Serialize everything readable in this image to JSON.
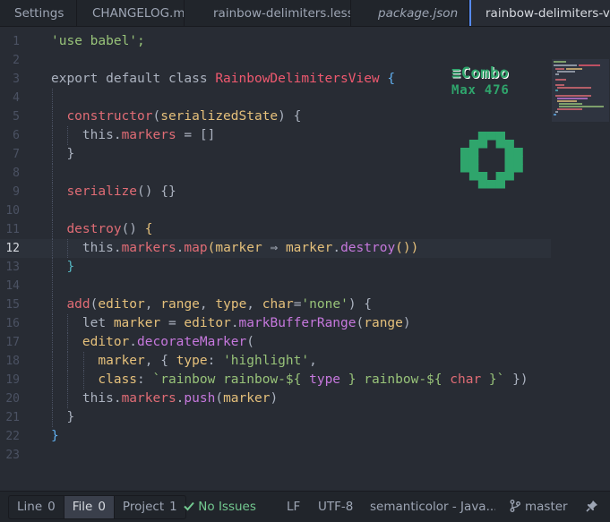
{
  "tabs": [
    {
      "label": "Settings"
    },
    {
      "label": "CHANGELOG.md"
    },
    {
      "label": "rainbow-delimiters.less"
    },
    {
      "label": "package.json"
    },
    {
      "label": "rainbow-delimiters-view.js"
    }
  ],
  "editor": {
    "current_line": 12,
    "lines": [
      {
        "n": "1",
        "indent": 0,
        "tokens": [
          [
            "str",
            "'use babel';"
          ]
        ]
      },
      {
        "n": "2",
        "indent": 0,
        "tokens": []
      },
      {
        "n": "3",
        "indent": 0,
        "tokens": [
          [
            "kw",
            "export default class "
          ],
          [
            "cls",
            "RainbowDelimitersView"
          ],
          [
            "plain",
            " "
          ],
          [
            "br3",
            "{"
          ]
        ]
      },
      {
        "n": "4",
        "indent": 1,
        "tokens": []
      },
      {
        "n": "5",
        "indent": 1,
        "tokens": [
          [
            "fn",
            "constructor"
          ],
          [
            "plain",
            "("
          ],
          [
            "pm",
            "serializedState"
          ],
          [
            "plain",
            ") {"
          ]
        ]
      },
      {
        "n": "6",
        "indent": 2,
        "tokens": [
          [
            "ths",
            "this"
          ],
          [
            "plain",
            "."
          ],
          [
            "prop",
            "markers"
          ],
          [
            "plain",
            " = []"
          ]
        ]
      },
      {
        "n": "7",
        "indent": 1,
        "tokens": [
          [
            "plain",
            "}"
          ]
        ]
      },
      {
        "n": "8",
        "indent": 1,
        "tokens": []
      },
      {
        "n": "9",
        "indent": 1,
        "tokens": [
          [
            "fn",
            "serialize"
          ],
          [
            "plain",
            "() {}"
          ]
        ]
      },
      {
        "n": "10",
        "indent": 1,
        "tokens": []
      },
      {
        "n": "11",
        "indent": 1,
        "tokens": [
          [
            "fn",
            "destroy"
          ],
          [
            "plain",
            "() "
          ],
          [
            "br2",
            "{"
          ]
        ]
      },
      {
        "n": "12",
        "indent": 2,
        "tokens": [
          [
            "ths",
            "this"
          ],
          [
            "plain",
            "."
          ],
          [
            "prop",
            "markers"
          ],
          [
            "plain",
            "."
          ],
          [
            "fn",
            "map"
          ],
          [
            "br2",
            "("
          ],
          [
            "pm",
            "marker"
          ],
          [
            "plain",
            " ⇒ "
          ],
          [
            "pm",
            "marker"
          ],
          [
            "plain",
            "."
          ],
          [
            "fb",
            "destroy"
          ],
          [
            "br2",
            "()"
          ],
          [
            "br2",
            ")"
          ]
        ]
      },
      {
        "n": "13",
        "indent": 1,
        "tokens": [
          [
            "br1",
            "}"
          ]
        ]
      },
      {
        "n": "14",
        "indent": 1,
        "tokens": []
      },
      {
        "n": "15",
        "indent": 1,
        "tokens": [
          [
            "fn",
            "add"
          ],
          [
            "plain",
            "("
          ],
          [
            "pm",
            "editor"
          ],
          [
            "plain",
            ", "
          ],
          [
            "pm",
            "range"
          ],
          [
            "plain",
            ", "
          ],
          [
            "pm",
            "type"
          ],
          [
            "plain",
            ", "
          ],
          [
            "pm",
            "char"
          ],
          [
            "plain",
            "="
          ],
          [
            "str",
            "'none'"
          ],
          [
            "plain",
            ") {"
          ]
        ]
      },
      {
        "n": "16",
        "indent": 2,
        "tokens": [
          [
            "kw",
            "let "
          ],
          [
            "pm",
            "marker"
          ],
          [
            "plain",
            " = "
          ],
          [
            "pm",
            "editor"
          ],
          [
            "plain",
            "."
          ],
          [
            "fb",
            "markBufferRange"
          ],
          [
            "plain",
            "("
          ],
          [
            "pm",
            "range"
          ],
          [
            "plain",
            ")"
          ]
        ]
      },
      {
        "n": "17",
        "indent": 2,
        "tokens": [
          [
            "pm",
            "editor"
          ],
          [
            "plain",
            "."
          ],
          [
            "fb",
            "decorateMarker"
          ],
          [
            "plain",
            "("
          ]
        ]
      },
      {
        "n": "18",
        "indent": 3,
        "tokens": [
          [
            "pm",
            "marker"
          ],
          [
            "plain",
            ", { "
          ],
          [
            "pm",
            "type"
          ],
          [
            "plain",
            ": "
          ],
          [
            "str",
            "'highlight'"
          ],
          [
            "plain",
            ","
          ]
        ]
      },
      {
        "n": "19",
        "indent": 3,
        "tokens": [
          [
            "pm",
            "class"
          ],
          [
            "plain",
            ": "
          ],
          [
            "str",
            "`rainbow rainbow-${ "
          ],
          [
            "ty",
            "type"
          ],
          [
            "str",
            " } rainbow-${ "
          ],
          [
            "ch",
            "char"
          ],
          [
            "str",
            " }`"
          ],
          [
            "plain",
            " })"
          ]
        ]
      },
      {
        "n": "20",
        "indent": 2,
        "tokens": [
          [
            "ths",
            "this"
          ],
          [
            "plain",
            "."
          ],
          [
            "prop",
            "markers"
          ],
          [
            "plain",
            "."
          ],
          [
            "fb",
            "push"
          ],
          [
            "plain",
            "("
          ],
          [
            "pm",
            "marker"
          ],
          [
            "plain",
            ")"
          ]
        ]
      },
      {
        "n": "21",
        "indent": 1,
        "tokens": [
          [
            "plain",
            "}"
          ]
        ]
      },
      {
        "n": "22",
        "indent": 0,
        "tokens": [
          [
            "br3",
            "}"
          ]
        ]
      },
      {
        "n": "23",
        "indent": 0,
        "tokens": []
      }
    ]
  },
  "combo": {
    "label": "≡Combo",
    "max_label": "Max 476",
    "count": 0,
    "color": "#2fa56c"
  },
  "status": {
    "line_tab": {
      "label": "Line",
      "count": "0"
    },
    "file_tab": {
      "label": "File",
      "count": "0"
    },
    "project_tab": {
      "label": "Project",
      "count": "1"
    },
    "issues_icon": "check-icon",
    "issues": "No Issues",
    "line_ending": "LF",
    "encoding": "UTF-8",
    "grammar": "semanticolor - Java...",
    "branch_icon": "git-branch-icon",
    "branch": "master",
    "pin_icon": "pin-icon"
  },
  "colors": {
    "background": "#282c34",
    "accent": "#568af2",
    "success": "#73c990"
  }
}
